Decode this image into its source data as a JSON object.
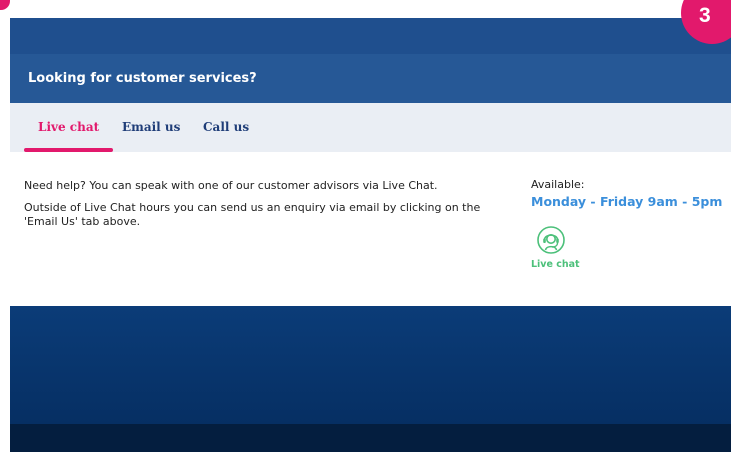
{
  "header": {
    "title": "Looking for customer services?"
  },
  "tabs": [
    {
      "label": "Live chat",
      "active": true
    },
    {
      "label": "Email us",
      "active": false
    },
    {
      "label": "Call us",
      "active": false
    }
  ],
  "content": {
    "line1": "Need help? You can speak with one of our customer advisors via Live Chat.",
    "line2": "Outside of Live Chat hours you can send us an enquiry via email by clicking on the 'Email Us' tab above."
  },
  "availability": {
    "label": "Available:",
    "hours": "Monday - Friday 9am - 5pm"
  },
  "chat_widget": {
    "label": "Live chat",
    "icon": "headset-icon"
  },
  "step_badge": {
    "number": "3"
  },
  "colors": {
    "accent": "#e2196c",
    "header_bg": "#265896",
    "hours_text": "#3b8fdb",
    "chat_green": "#4cc07a"
  }
}
